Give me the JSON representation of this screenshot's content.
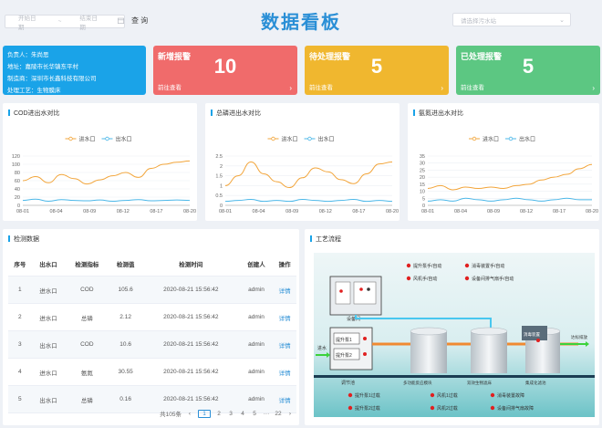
{
  "header": {
    "title": "数据看板",
    "start_placeholder": "开始日期",
    "separator": "~",
    "end_placeholder": "结束日期",
    "query_label": "查 询",
    "device_placeholder": "请选择污水站"
  },
  "info": {
    "owner": "负责人：朱尚思",
    "address": "地址：嘉陵市长华镇东平村",
    "manufacturer": "制造商：深圳市长鑫科技有限公司",
    "process": "处理工艺：生物膜床"
  },
  "stats": [
    {
      "label": "新增报警",
      "value": "10",
      "link": "前往查看",
      "color": "#f06b6b"
    },
    {
      "label": "待处理报警",
      "value": "5",
      "link": "前往查看",
      "color": "#f0b72f"
    },
    {
      "label": "已处理报警",
      "value": "5",
      "link": "前往查看",
      "color": "#5cc782"
    }
  ],
  "charts": {
    "cod": {
      "title": "COD进出水对比",
      "legend_in": "进水口",
      "legend_out": "出水口"
    },
    "tp": {
      "title": "总磷进出水对比",
      "legend_in": "进水口",
      "legend_out": "出水口"
    },
    "nh": {
      "title": "氨氮进出水对比",
      "legend_in": "进水口",
      "legend_out": "出水口"
    }
  },
  "chart_data": [
    {
      "type": "line",
      "title": "COD进出水对比",
      "x": [
        "08-01",
        "08-04",
        "08-09",
        "08-12",
        "08-17",
        "08-20"
      ],
      "ylim": [
        0,
        120
      ],
      "yticks": [
        "0",
        "20",
        "40",
        "60",
        "80",
        "100",
        "120"
      ],
      "series": [
        {
          "name": "进水口",
          "color": "#f2a53b",
          "values": [
            60,
            70,
            55,
            75,
            65,
            52,
            62,
            72,
            80,
            68,
            90,
            100,
            105,
            108
          ]
        },
        {
          "name": "出水口",
          "color": "#4bb7e8",
          "values": [
            12,
            15,
            10,
            14,
            12,
            11,
            13,
            10,
            12,
            14,
            11,
            12,
            13,
            12
          ]
        }
      ]
    },
    {
      "type": "line",
      "title": "总磷进出水对比",
      "x": [
        "08-01",
        "08-04",
        "08-09",
        "08-12",
        "08-17",
        "08-20"
      ],
      "ylim": [
        0,
        2.5
      ],
      "yticks": [
        "0",
        "0.5",
        "1",
        "1.5",
        "2",
        "2.5"
      ],
      "series": [
        {
          "name": "进水口",
          "color": "#f2a53b",
          "values": [
            1.0,
            1.5,
            2.2,
            1.6,
            1.2,
            0.9,
            1.4,
            1.9,
            1.7,
            1.3,
            1.1,
            1.6,
            2.1,
            2.2
          ]
        },
        {
          "name": "出水口",
          "color": "#4bb7e8",
          "values": [
            0.2,
            0.25,
            0.3,
            0.2,
            0.25,
            0.2,
            0.3,
            0.25,
            0.2,
            0.25,
            0.3,
            0.2,
            0.25,
            0.2
          ]
        }
      ]
    },
    {
      "type": "line",
      "title": "氨氮进出水对比",
      "x": [
        "08-01",
        "08-04",
        "08-09",
        "08-12",
        "08-17",
        "08-20"
      ],
      "ylim": [
        0,
        35
      ],
      "yticks": [
        "0",
        "5",
        "10",
        "15",
        "20",
        "25",
        "30",
        "35"
      ],
      "series": [
        {
          "name": "进水口",
          "color": "#f2a53b",
          "values": [
            12,
            14,
            11,
            13,
            12,
            13,
            12,
            14,
            15,
            18,
            20,
            22,
            26,
            29
          ]
        },
        {
          "name": "出水口",
          "color": "#4bb7e8",
          "values": [
            3,
            4,
            3,
            5,
            4,
            3,
            4,
            5,
            4,
            3,
            4,
            5,
            4,
            4
          ]
        }
      ]
    }
  ],
  "table": {
    "title": "检测数据",
    "headers": [
      "序号",
      "出水口",
      "检测指标",
      "检测值",
      "检测时间",
      "创建人",
      "操作"
    ],
    "rows": [
      [
        "1",
        "进水口",
        "COD",
        "105.6",
        "2020-08-21 15:56:42",
        "admin",
        "详情"
      ],
      [
        "2",
        "进水口",
        "总磷",
        "2.12",
        "2020-08-21 15:56:42",
        "admin",
        "详情"
      ],
      [
        "3",
        "出水口",
        "COD",
        "10.6",
        "2020-08-21 15:56:42",
        "admin",
        "详情"
      ],
      [
        "4",
        "进水口",
        "氨氮",
        "30.55",
        "2020-08-21 15:56:42",
        "admin",
        "详情"
      ],
      [
        "5",
        "出水口",
        "总磷",
        "0.16",
        "2020-08-21 15:56:42",
        "admin",
        "详情"
      ]
    ],
    "pager": {
      "total": "共105条",
      "prev": "‹",
      "pages": [
        "1",
        "2",
        "3",
        "4",
        "5"
      ],
      "ellipsis": "···",
      "last": "22",
      "next": "›"
    }
  },
  "process": {
    "title": "工艺流程",
    "status_top": [
      "提升泵手/自动",
      "风机手/自动",
      "消毒装置手/自动",
      "设备间排气扇手/自动"
    ],
    "status_bottom": [
      "提升泵1过载",
      "提升泵2过载",
      "风机1过载",
      "风机2过载",
      "消毒装置故障",
      "设备间排气扇故障"
    ],
    "labels": {
      "inlet": "进水",
      "pump1": "提升泵1",
      "pump2": "提升泵2",
      "tank": "调节池",
      "reactor1": "多功能反应模块",
      "reactor2": "双效生物滤床",
      "reactor3": "集成化滤池",
      "disinfect": "消毒装置",
      "outlet": "达标排放",
      "control": "设备间"
    }
  }
}
